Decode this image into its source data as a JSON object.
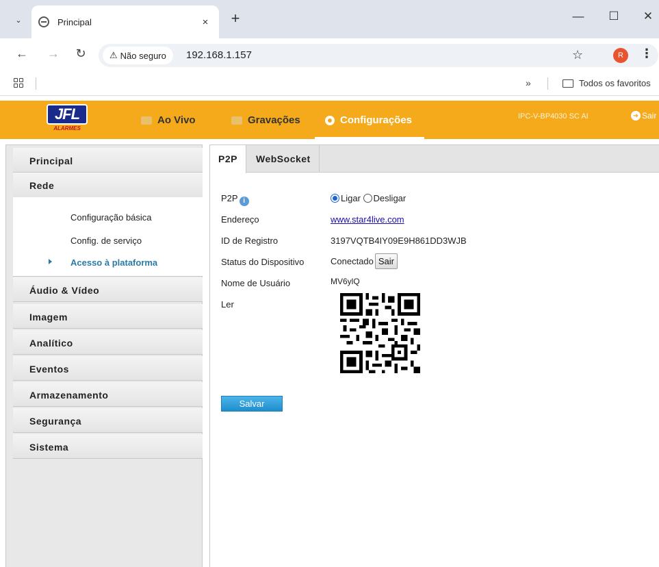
{
  "browser": {
    "tab_title": "Principal",
    "tab_close": "×",
    "new_tab": "+",
    "security_label": "Não seguro",
    "url": "192.168.1.157",
    "avatar_letter": "R",
    "bookmarks_more": "»",
    "bookmarks_folder": "Todos os favoritos"
  },
  "app": {
    "logo_mark": "JFL",
    "logo_sub": "ALARMES",
    "nav": [
      {
        "label": "Ao Vivo"
      },
      {
        "label": "Gravações"
      },
      {
        "label": "Configurações"
      }
    ],
    "device_name": "IPC-V-BP4030 SC AI",
    "logout_label": "Sair",
    "accent_color": "#f5aa1c"
  },
  "sidebar": {
    "items": [
      {
        "label": "Principal"
      },
      {
        "label": "Rede"
      },
      {
        "label": "Áudio & Vídeo"
      },
      {
        "label": "Imagem"
      },
      {
        "label": "Analítico"
      },
      {
        "label": "Eventos"
      },
      {
        "label": "Armazenamento"
      },
      {
        "label": "Segurança"
      },
      {
        "label": "Sistema"
      }
    ],
    "sub_items": [
      {
        "label": "Configuração básica"
      },
      {
        "label": "Config. de serviço"
      },
      {
        "label": "Acesso à plataforma"
      }
    ]
  },
  "content": {
    "tabs": [
      {
        "label": "P2P"
      },
      {
        "label": "WebSocket"
      }
    ],
    "fields": {
      "p2p_label": "P2P",
      "p2p_on": "Ligar",
      "p2p_off": "Desligar",
      "address_label": "Endereço",
      "address_value": "www.star4live.com",
      "reg_id_label": "ID de Registro",
      "reg_id_value": "3197VQTB4IY09E9H861DD3WJB",
      "status_label": "Status do Dispositivo",
      "status_value": "Conectado",
      "status_button": "Sair",
      "user_label": "Nome de Usuário",
      "user_value": "MV6ylQ",
      "read_label": "Ler"
    },
    "save_button": "Salvar"
  }
}
